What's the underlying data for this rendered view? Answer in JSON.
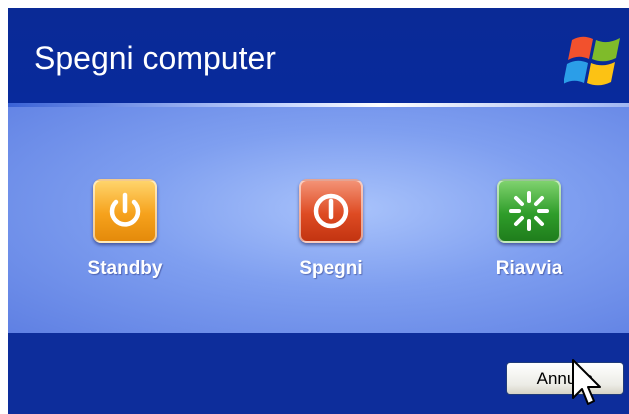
{
  "dialog": {
    "title": "Spegni computer",
    "logo_icon": "windows-flag-logo",
    "options": [
      {
        "id": "standby",
        "label": "Standby",
        "icon": "power-standby-icon",
        "color": "#f6a21c"
      },
      {
        "id": "spegni",
        "label": "Spegni",
        "icon": "power-off-icon",
        "color": "#de4b23"
      },
      {
        "id": "riavvia",
        "label": "Riavvia",
        "icon": "restart-icon",
        "color": "#2f9d2a"
      }
    ],
    "cancel_label": "Annulla"
  },
  "colors": {
    "header_bg": "#0a2a96",
    "body_bg": "#7f9ff0",
    "footer_bg": "#0d2d9b"
  }
}
